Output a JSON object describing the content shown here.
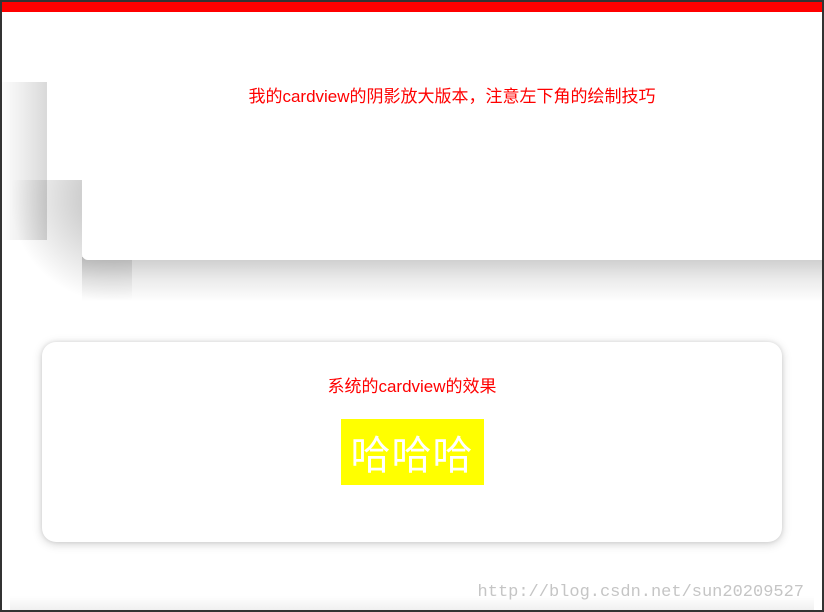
{
  "header": {
    "bar_color": "#ff0000"
  },
  "custom_card": {
    "caption": "我的cardview的阴影放大版本，注意左下角的绘制技巧"
  },
  "system_card": {
    "caption": "系统的cardview的效果",
    "highlight_text": "哈哈哈",
    "highlight_bg": "#ffff00",
    "highlight_fg": "#ffffff"
  },
  "watermark": "http://blog.csdn.net/sun20209527"
}
